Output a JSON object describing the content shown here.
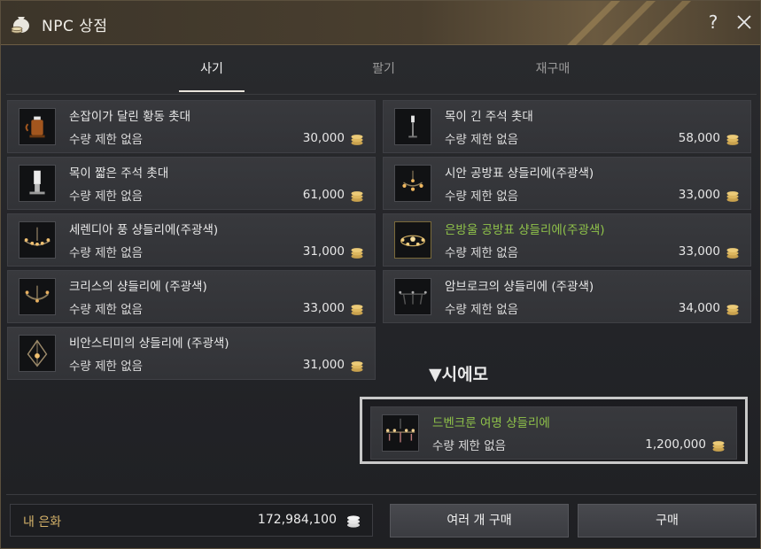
{
  "window": {
    "title": "NPC 상점",
    "help_label": "?"
  },
  "tabs": [
    {
      "label": "사기",
      "active": true
    },
    {
      "label": "팔기",
      "active": false
    },
    {
      "label": "재구매",
      "active": false
    }
  ],
  "items": [
    {
      "name": "손잡이가 달린 황동 촛대",
      "limit": "수량 제한 없음",
      "price": "30,000",
      "name_color": "#e8e8e8",
      "icon": "brass-candlestick-icon"
    },
    {
      "name": "목이 긴 주석 촛대",
      "limit": "수량 제한 없음",
      "price": "58,000",
      "name_color": "#e8e8e8",
      "icon": "tall-tin-candlestick-icon"
    },
    {
      "name": "목이 짧은 주석 촛대",
      "limit": "수량 제한 없음",
      "price": "61,000",
      "name_color": "#e8e8e8",
      "icon": "short-tin-candlestick-icon"
    },
    {
      "name": "시안 공방표 샹들리에(주광색)",
      "limit": "수량 제한 없음",
      "price": "33,000",
      "name_color": "#e8e8e8",
      "icon": "chandelier-icon"
    },
    {
      "name": "세렌디아 풍 샹들리에(주광색)",
      "limit": "수량 제한 없음",
      "price": "31,000",
      "name_color": "#e8e8e8",
      "icon": "chandelier-icon"
    },
    {
      "name": "은방울 공방표 샹들리에(주광색)",
      "limit": "수량 제한 없음",
      "price": "33,000",
      "name_color": "#8fc24a",
      "icon": "chandelier-icon"
    },
    {
      "name": "크리스의 샹들리에 (주광색)",
      "limit": "수량 제한 없음",
      "price": "33,000",
      "name_color": "#e8e8e8",
      "icon": "chandelier-icon"
    },
    {
      "name": "암브로크의 샹들리에 (주광색)",
      "limit": "수량 제한 없음",
      "price": "34,000",
      "name_color": "#e8e8e8",
      "icon": "chandelier-icon"
    },
    {
      "name": "비안스티미의 샹들리에 (주광색)",
      "limit": "수량 제한 없음",
      "price": "31,000",
      "name_color": "#e8e8e8",
      "icon": "lantern-chandelier-icon"
    }
  ],
  "annotation": {
    "label": "▼시에모"
  },
  "highlighted_item": {
    "name": "드벤크룬 여명 샹들리에",
    "limit": "수량 제한 없음",
    "price": "1,200,000",
    "name_color": "#8fc24a",
    "icon": "dawn-chandelier-icon"
  },
  "footer": {
    "silver_label": "내 은화",
    "silver_amount": "172,984,100",
    "bulk_buy_label": "여러 개 구매",
    "buy_label": "구매"
  },
  "colors": {
    "accent_gold": "#d6b36a",
    "green_name": "#8fc24a",
    "background": "#232428"
  }
}
